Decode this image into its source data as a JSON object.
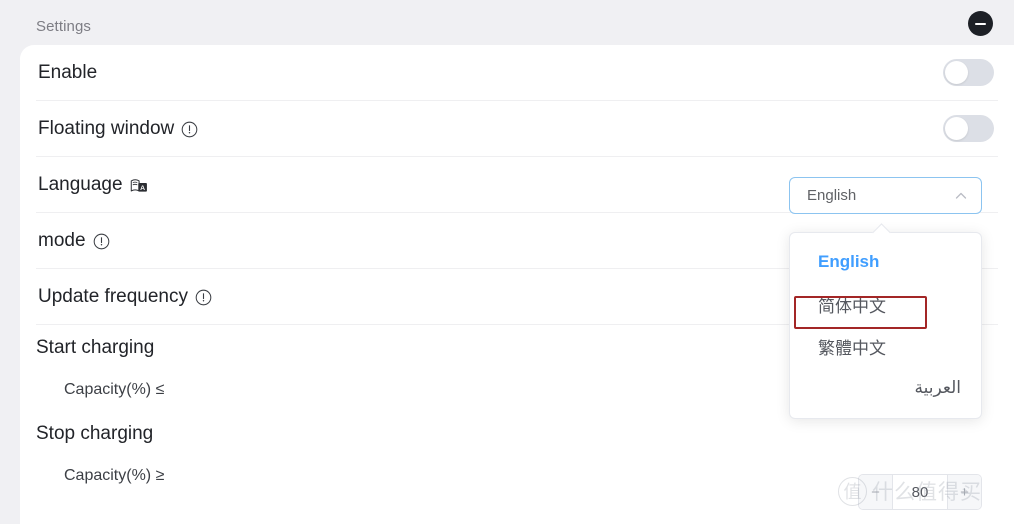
{
  "window": {
    "title": "Settings",
    "minimize_label": "Minimize",
    "minimize_icon": "minus-circle-icon"
  },
  "settings": {
    "rows": [
      {
        "label": "Enable",
        "icon": null,
        "control": "toggle",
        "toggle_on": false
      },
      {
        "label": "Floating window",
        "icon": "warning-icon",
        "control": "toggle",
        "toggle_on": false
      },
      {
        "label": "Language",
        "icon": "translate-icon",
        "control": "select"
      },
      {
        "label": "mode",
        "icon": "warning-icon",
        "control": "none"
      },
      {
        "label": "Update frequency",
        "icon": "warning-icon",
        "control": "none"
      }
    ],
    "groups": [
      {
        "title": "Start charging",
        "sub_label": "Capacity(%) ≤",
        "value": ""
      },
      {
        "title": "Stop charging",
        "sub_label": "Capacity(%) ≥",
        "value": "80"
      }
    ]
  },
  "language_select": {
    "value": "English",
    "chevron_icon": "chevron-up-icon",
    "expanded": true,
    "options": [
      {
        "label": "English",
        "selected": true,
        "annotated": false
      },
      {
        "label": "简体中文",
        "selected": false,
        "annotated": true
      },
      {
        "label": "繁體中文",
        "selected": false,
        "annotated": false
      },
      {
        "label": "العربية",
        "selected": false,
        "annotated": false,
        "rtl": true
      }
    ]
  },
  "stepper": {
    "decrement_label": "−",
    "increment_label": "+",
    "value": "80"
  },
  "watermark": {
    "mark": "值",
    "text": "什么值得买"
  },
  "colors": {
    "accent": "#409eff",
    "annotation": "#a32626",
    "page_bg": "#f0f0f3",
    "card_bg": "#ffffff",
    "toggle_off": "#dcdfe6",
    "minimize_bg": "#1d2026"
  }
}
